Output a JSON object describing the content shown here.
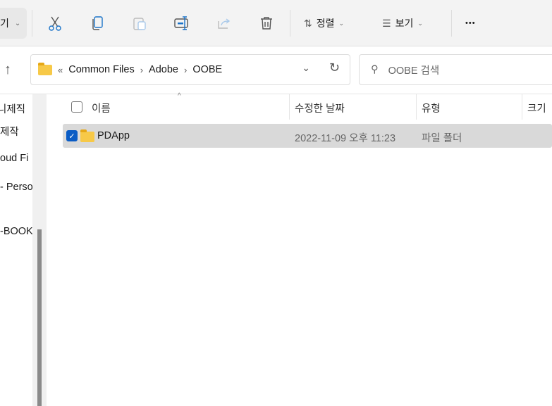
{
  "toolbar": {
    "new_label": "기",
    "sort_label": "정렬",
    "view_label": "보기",
    "more": "•••"
  },
  "address": {
    "overflow": "«",
    "crumbs": [
      "Common Files",
      "Adobe",
      "OOBE"
    ]
  },
  "search": {
    "placeholder": "OOBE 검색"
  },
  "nav": {
    "items": [
      "니제직",
      "제작",
      "oud Fi",
      "- Perso",
      "-BOOK"
    ]
  },
  "columns": {
    "name": "이름",
    "date": "수정한 날짜",
    "type": "유형",
    "size": "크기"
  },
  "files": [
    {
      "name": "PDApp",
      "date": "2022-11-09 오후 11:23",
      "type": "파일 폴더",
      "checked": true
    }
  ]
}
